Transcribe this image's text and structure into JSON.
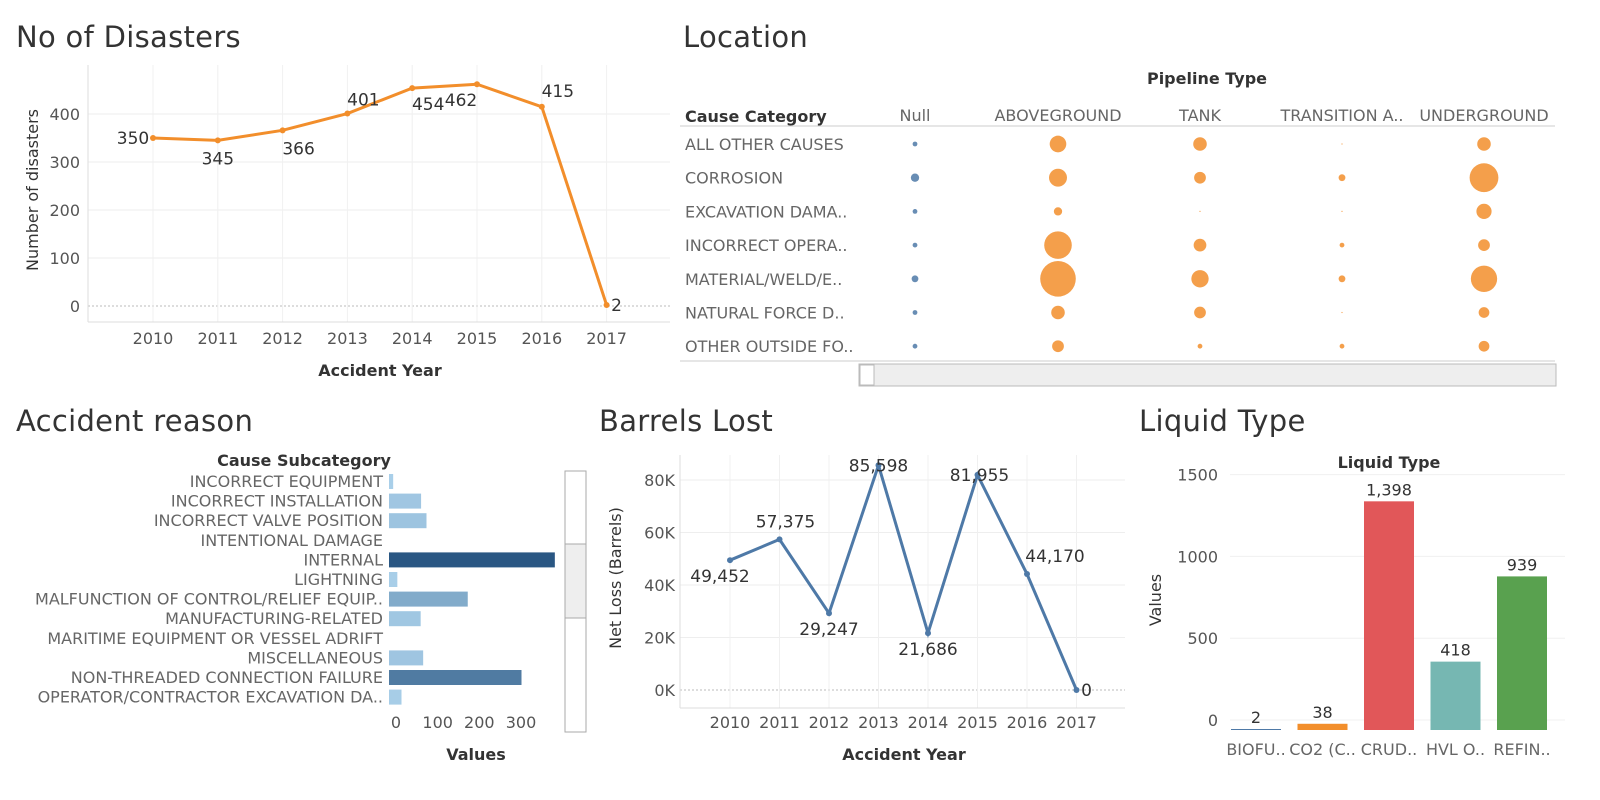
{
  "panels": {
    "disasters_title": "No of Disasters",
    "location_title": "Location",
    "reason_title": "Accident reason",
    "barrels_title": "Barrels Lost",
    "liquid_title": "Liquid Type"
  },
  "chart_data": [
    {
      "id": "disasters",
      "type": "line",
      "x": [
        "2010",
        "2011",
        "2012",
        "2013",
        "2014",
        "2015",
        "2016",
        "2017"
      ],
      "values": [
        350,
        345,
        366,
        401,
        454,
        462,
        415,
        2
      ],
      "data_labels": [
        "350",
        "345",
        "366",
        "401",
        "454",
        "462",
        "415",
        "2"
      ],
      "xlabel": "Accident Year",
      "ylabel": "Number of disasters",
      "ylim": [
        0,
        470
      ],
      "yticks": [
        0,
        100,
        200,
        300,
        400
      ],
      "grid": true,
      "color": "#f28e2b"
    },
    {
      "id": "location",
      "type": "scatter",
      "title": "Pipeline Type",
      "row_header": "Cause Category",
      "columns": [
        "Null",
        "ABOVEGROUND",
        "TANK",
        "TRANSITION A..",
        "UNDERGROUND"
      ],
      "rows": [
        "ALL OTHER CAUSES",
        "CORROSION",
        "EXCAVATION DAMA..",
        "INCORRECT OPERA..",
        "MATERIAL/WELD/E..",
        "NATURAL FORCE D..",
        "OTHER OUTSIDE FO.."
      ],
      "size_matrix": [
        [
          1,
          12,
          8,
          0,
          8
        ],
        [
          3,
          14,
          6,
          2,
          36
        ],
        [
          1,
          3,
          0,
          0,
          10
        ],
        [
          1,
          33,
          7,
          1,
          6
        ],
        [
          2,
          55,
          13,
          2,
          30
        ],
        [
          1,
          8,
          6,
          0,
          5
        ],
        [
          1,
          6,
          1,
          1,
          5
        ]
      ],
      "color": "#f28e2b"
    },
    {
      "id": "reason",
      "type": "bar",
      "orientation": "horizontal",
      "row_header": "Cause Subcategory",
      "categories": [
        "INCORRECT EQUIPMENT",
        "INCORRECT INSTALLATION",
        "INCORRECT VALVE POSITION",
        "INTENTIONAL DAMAGE",
        "INTERNAL",
        "LIGHTNING",
        "MALFUNCTION OF CONTROL/RELIEF EQUIP..",
        "MANUFACTURING-RELATED",
        "MARITIME EQUIPMENT OR VESSEL ADRIFT",
        "MISCELLANEOUS",
        "NON-THREADED CONNECTION FAILURE",
        "OPERATOR/CONTRACTOR EXCAVATION DA.."
      ],
      "values": [
        10,
        77,
        90,
        0,
        398,
        20,
        189,
        76,
        0,
        82,
        318,
        30
      ],
      "xlabel": "Values",
      "xlim": [
        0,
        400
      ],
      "xticks": [
        0,
        100,
        200,
        300
      ],
      "color_range": [
        "#a9cfe9",
        "#2a5783"
      ]
    },
    {
      "id": "barrels",
      "type": "line",
      "x": [
        "2010",
        "2011",
        "2012",
        "2013",
        "2014",
        "2015",
        "2016",
        "2017"
      ],
      "values": [
        49452,
        57375,
        29247,
        85598,
        21686,
        81955,
        44170,
        0
      ],
      "data_labels": [
        "49,452",
        "57,375",
        "29,247",
        "85,598",
        "21,686",
        "81,955",
        "44,170",
        "0"
      ],
      "xlabel": "Accident Year",
      "ylabel": "Net Loss (Barrels)",
      "ylim": [
        0,
        88000
      ],
      "yticks": [
        0,
        20000,
        40000,
        60000,
        80000
      ],
      "ytick_labels": [
        "0K",
        "20K",
        "40K",
        "60K",
        "80K"
      ],
      "grid": true,
      "color": "#4e79a7"
    },
    {
      "id": "liquid",
      "type": "bar",
      "title": "Liquid Type",
      "categories": [
        "BIOFU..",
        "CO2 (C..",
        "CRUD..",
        "HVL O..",
        "REFIN.."
      ],
      "values": [
        2,
        38,
        1398,
        418,
        939
      ],
      "data_labels": [
        "2",
        "38",
        "1,398",
        "418",
        "939"
      ],
      "colors": [
        "#4e79a7",
        "#f28e2b",
        "#e15759",
        "#76b7b2",
        "#59a14f"
      ],
      "ylabel": "Values",
      "ylim": [
        0,
        1650
      ],
      "yticks": [
        0,
        500,
        1000,
        1500
      ]
    }
  ]
}
